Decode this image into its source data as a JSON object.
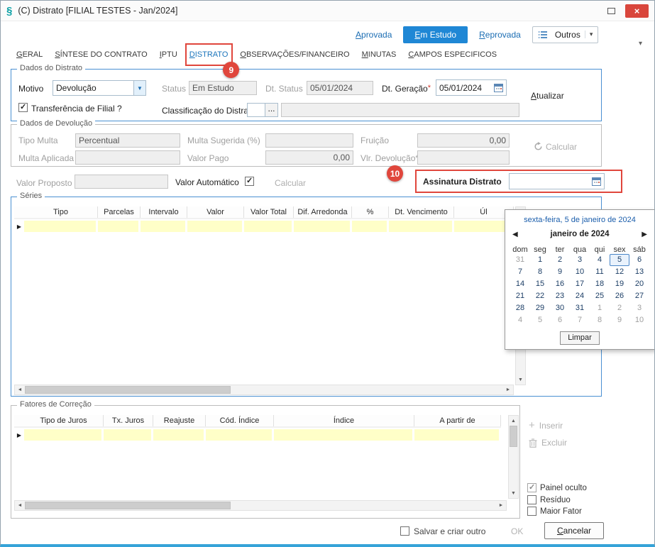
{
  "window": {
    "title": "(C) Distrato [FILIAL TESTES - Jan/2024]"
  },
  "workflow": {
    "aprovada": "Aprovada",
    "em_estudo": "Em Estudo",
    "reprovada": "Reprovada",
    "outros": "Outros"
  },
  "tabs": {
    "geral": "GERAL",
    "sintese": "SÍNTESE DO CONTRATO",
    "iptu": "IPTU",
    "distrato": "DISTRATO",
    "observacoes": "OBSERVAÇÕES/FINANCEIRO",
    "minutas": "MINUTAS",
    "campos": "CAMPOS ESPECIFICOS"
  },
  "annotations": {
    "step9": "9",
    "step10": "10"
  },
  "dados_distrato": {
    "legend": "Dados do Distrato",
    "motivo_label": "Motivo",
    "motivo_value": "Devolução",
    "status_label": "Status",
    "status_value": "Em Estudo",
    "dt_status_label": "Dt. Status",
    "dt_status_value": "05/01/2024",
    "dt_geracao_label": "Dt. Geração",
    "dt_geracao_required": "*",
    "dt_geracao_value": "05/01/2024",
    "atualizar_label": "Atualizar",
    "transferencia_label": "Transferência de Filial ?",
    "classificacao_label": "Classificação do Distrato",
    "classificacao_browse": "..."
  },
  "dados_devolucao": {
    "legend": "Dados de Devolução",
    "tipo_multa_label": "Tipo Multa",
    "tipo_multa_value": "Percentual",
    "multa_sugerida_label": "Multa Sugerida (%)",
    "fruicao_label": "Fruição",
    "fruicao_value": "0,00",
    "multa_aplicada_label": "Multa Aplicada (%)",
    "valor_pago_label": "Valor Pago",
    "valor_pago_value": "0,00",
    "vlr_devolucao_label": "Vlr. Devolução*",
    "calcular_label": "Calcular"
  },
  "valor_row": {
    "valor_proposto_label": "Valor Proposto",
    "valor_automatico_label": "Valor Automático",
    "calcular_label": "Calcular",
    "assinatura_label": "Assinatura Distrato"
  },
  "calendar": {
    "header": "sexta-feira, 5 de janeiro de 2024",
    "month": "janeiro de 2024",
    "prev": "◀",
    "next": "▶",
    "day_names": [
      "dom",
      "seg",
      "ter",
      "qua",
      "qui",
      "sex",
      "sáb"
    ],
    "weeks": [
      [
        {
          "d": "31",
          "m": true
        },
        {
          "d": "1"
        },
        {
          "d": "2"
        },
        {
          "d": "3"
        },
        {
          "d": "4"
        },
        {
          "d": "5",
          "sel": true
        },
        {
          "d": "6"
        }
      ],
      [
        {
          "d": "7"
        },
        {
          "d": "8"
        },
        {
          "d": "9"
        },
        {
          "d": "10"
        },
        {
          "d": "11"
        },
        {
          "d": "12"
        },
        {
          "d": "13"
        }
      ],
      [
        {
          "d": "14"
        },
        {
          "d": "15"
        },
        {
          "d": "16"
        },
        {
          "d": "17"
        },
        {
          "d": "18"
        },
        {
          "d": "19"
        },
        {
          "d": "20"
        }
      ],
      [
        {
          "d": "21"
        },
        {
          "d": "22"
        },
        {
          "d": "23"
        },
        {
          "d": "24"
        },
        {
          "d": "25"
        },
        {
          "d": "26"
        },
        {
          "d": "27"
        }
      ],
      [
        {
          "d": "28"
        },
        {
          "d": "29"
        },
        {
          "d": "30"
        },
        {
          "d": "31"
        },
        {
          "d": "1",
          "m": true
        },
        {
          "d": "2",
          "m": true
        },
        {
          "d": "3",
          "m": true
        }
      ],
      [
        {
          "d": "4",
          "m": true
        },
        {
          "d": "5",
          "m": true
        },
        {
          "d": "6",
          "m": true
        },
        {
          "d": "7",
          "m": true
        },
        {
          "d": "8",
          "m": true
        },
        {
          "d": "9",
          "m": true
        },
        {
          "d": "10",
          "m": true
        }
      ]
    ],
    "clear": "Limpar"
  },
  "series": {
    "legend": "Séries",
    "headers": [
      "Tipo",
      "Parcelas",
      "Intervalo",
      "Valor",
      "Valor Total",
      "Dif. Arredonda",
      "%",
      "Dt. Vencimento",
      "Úl"
    ]
  },
  "fatores": {
    "legend": "Fatores de Correção",
    "headers": [
      "Tipo de Juros",
      "Tx. Juros",
      "Reajuste",
      "Cód. Índice",
      "Índice",
      "A partir de"
    ],
    "inserir": "Inserir",
    "excluir": "Excluir",
    "painel_oculto": "Painel oculto",
    "residuo": "Resíduo",
    "maior_fator": "Maior Fator"
  },
  "footer": {
    "salvar_label": "Salvar e criar outro",
    "ok": "OK",
    "cancelar": "Cancelar"
  },
  "colors": {
    "accent_blue": "#1f87d5",
    "annotation_red": "#e0463c",
    "row_yellow": "#ffffc8",
    "link_blue": "#1b6db3",
    "close_red": "#d9463c"
  }
}
